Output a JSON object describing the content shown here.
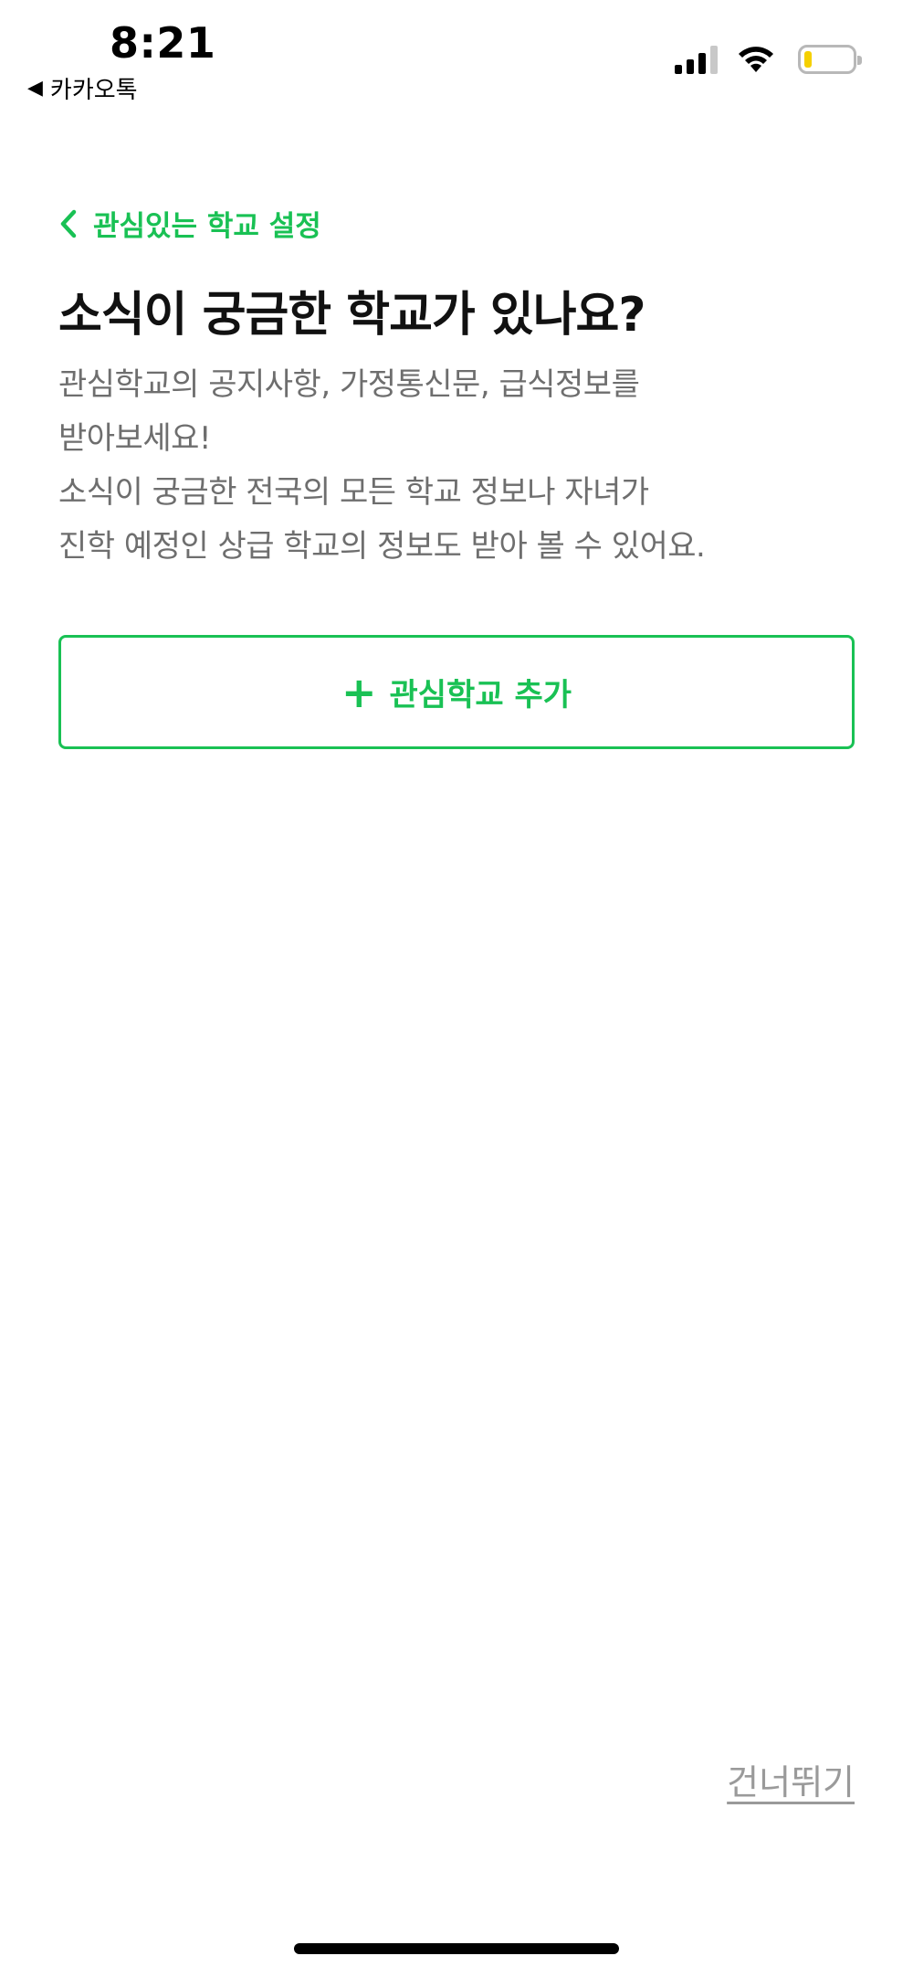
{
  "status_bar": {
    "time": "8:21",
    "back_app_label": "카카오톡",
    "back_arrow": "◀"
  },
  "nav": {
    "back_label": "관심있는 학교 설정"
  },
  "headline": "소식이 궁금한 학교가 있나요?",
  "description_lines": [
    "관심학교의 공지사항, 가정통신문, 급식정보를",
    "받아보세요!",
    "소식이 궁금한 전국의 모든 학교 정보나 자녀가",
    "진학 예정인 상급 학교의 정보도 받아 볼 수 있어요."
  ],
  "add_button": {
    "icon": "+",
    "label": "관심학교 추가"
  },
  "skip_label": "건너뛰기",
  "colors": {
    "accent": "#19c154",
    "battery_fill": "#f5d000",
    "body_text": "#6e6e6e"
  },
  "icons": {
    "back": "chevron-left-icon",
    "signal": "cellular-signal-icon",
    "wifi": "wifi-icon",
    "battery": "battery-icon",
    "plus": "plus-icon"
  }
}
